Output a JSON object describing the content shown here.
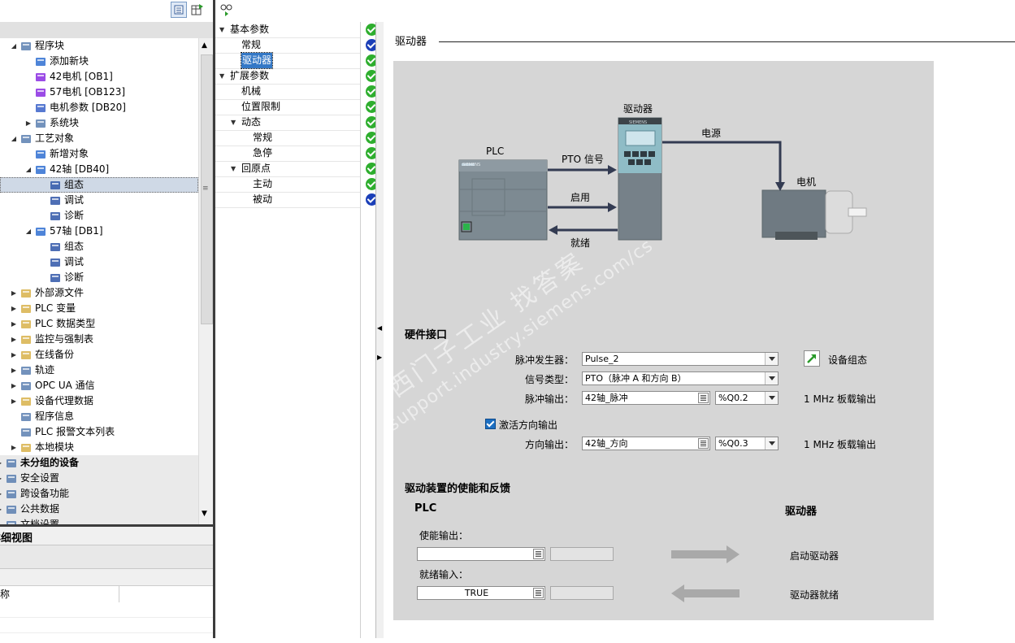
{
  "tree": {
    "items": [
      {
        "label": "程序块",
        "depth": 1,
        "arrow": "down",
        "icon": "program-blocks-icon"
      },
      {
        "label": "添加新块",
        "depth": 2,
        "arrow": "",
        "icon": "add-block-icon"
      },
      {
        "label": "42电机 [OB1]",
        "depth": 2,
        "arrow": "",
        "icon": "ob-block-icon"
      },
      {
        "label": "57电机 [OB123]",
        "depth": 2,
        "arrow": "",
        "icon": "ob-block-icon"
      },
      {
        "label": "电机参数 [DB20]",
        "depth": 2,
        "arrow": "",
        "icon": "db-block-icon"
      },
      {
        "label": "系统块",
        "depth": 2,
        "arrow": "right",
        "icon": "system-blocks-icon"
      },
      {
        "label": "工艺对象",
        "depth": 1,
        "arrow": "down",
        "icon": "technology-objects-icon"
      },
      {
        "label": "新增对象",
        "depth": 2,
        "arrow": "",
        "icon": "add-object-icon"
      },
      {
        "label": "42轴 [DB40]",
        "depth": 2,
        "arrow": "down",
        "icon": "axis-icon"
      },
      {
        "label": "组态",
        "depth": 3,
        "arrow": "",
        "icon": "configuration-icon",
        "selected": true
      },
      {
        "label": "调试",
        "depth": 3,
        "arrow": "",
        "icon": "commissioning-icon"
      },
      {
        "label": "诊断",
        "depth": 3,
        "arrow": "",
        "icon": "diagnostics-icon"
      },
      {
        "label": "57轴 [DB1]",
        "depth": 2,
        "arrow": "down",
        "icon": "axis-icon"
      },
      {
        "label": "组态",
        "depth": 3,
        "arrow": "",
        "icon": "configuration-icon"
      },
      {
        "label": "调试",
        "depth": 3,
        "arrow": "",
        "icon": "commissioning-icon"
      },
      {
        "label": "诊断",
        "depth": 3,
        "arrow": "",
        "icon": "diagnostics-icon"
      },
      {
        "label": "外部源文件",
        "depth": 1,
        "arrow": "right",
        "icon": "folder-icon"
      },
      {
        "label": "PLC 变量",
        "depth": 1,
        "arrow": "right",
        "icon": "folder-icon"
      },
      {
        "label": "PLC 数据类型",
        "depth": 1,
        "arrow": "right",
        "icon": "folder-icon"
      },
      {
        "label": "监控与强制表",
        "depth": 1,
        "arrow": "right",
        "icon": "folder-icon"
      },
      {
        "label": "在线备份",
        "depth": 1,
        "arrow": "right",
        "icon": "folder-icon"
      },
      {
        "label": "轨迹",
        "depth": 1,
        "arrow": "right",
        "icon": "trace-icon"
      },
      {
        "label": "OPC UA 通信",
        "depth": 1,
        "arrow": "right",
        "icon": "opc-ua-icon"
      },
      {
        "label": "设备代理数据",
        "depth": 1,
        "arrow": "right",
        "icon": "folder-icon"
      },
      {
        "label": "程序信息",
        "depth": 1,
        "arrow": "",
        "icon": "program-info-icon"
      },
      {
        "label": "PLC 报警文本列表",
        "depth": 1,
        "arrow": "",
        "icon": "alarm-text-icon"
      },
      {
        "label": "本地模块",
        "depth": 1,
        "arrow": "right",
        "icon": "folder-icon"
      },
      {
        "label": "未分组的设备",
        "depth": 0,
        "arrow": "right",
        "icon": "devices-icon",
        "bold": true,
        "group": true
      },
      {
        "label": "安全设置",
        "depth": 0,
        "arrow": "right",
        "icon": "security-icon",
        "group": true
      },
      {
        "label": "跨设备功能",
        "depth": 0,
        "arrow": "right",
        "icon": "cross-device-icon",
        "group": true
      },
      {
        "label": "公共数据",
        "depth": 0,
        "arrow": "right",
        "icon": "common-data-icon",
        "group": true
      },
      {
        "label": "文档设置",
        "depth": 0,
        "arrow": "right",
        "icon": "doc-settings-icon",
        "group": true
      }
    ]
  },
  "detail_view": {
    "title": "详细视图",
    "col_name": "名称"
  },
  "nav": {
    "items": [
      {
        "label": "基本参数",
        "depth": 0,
        "arrow": "down",
        "status": "green"
      },
      {
        "label": "常规",
        "depth": 1,
        "arrow": "",
        "status": "blue"
      },
      {
        "label": "驱动器",
        "depth": 1,
        "arrow": "",
        "status": "green",
        "selected": true
      },
      {
        "label": "扩展参数",
        "depth": 0,
        "arrow": "down",
        "status": "green"
      },
      {
        "label": "机械",
        "depth": 1,
        "arrow": "",
        "status": "green"
      },
      {
        "label": "位置限制",
        "depth": 1,
        "arrow": "",
        "status": "green"
      },
      {
        "label": "动态",
        "depth": 1,
        "arrow": "down",
        "status": "green"
      },
      {
        "label": "常规",
        "depth": 2,
        "arrow": "",
        "status": "green"
      },
      {
        "label": "急停",
        "depth": 2,
        "arrow": "",
        "status": "green"
      },
      {
        "label": "回原点",
        "depth": 1,
        "arrow": "down",
        "status": "green"
      },
      {
        "label": "主动",
        "depth": 2,
        "arrow": "",
        "status": "green"
      },
      {
        "label": "被动",
        "depth": 2,
        "arrow": "",
        "status": "blue"
      }
    ]
  },
  "main": {
    "section_title": "驱动器",
    "diagram": {
      "plc_label": "PLC",
      "drive_label": "驱动器",
      "motor_label": "电机",
      "power_label": "电源",
      "pto_label": "PTO 信号",
      "enable_label": "启用",
      "ready_label": "就绪",
      "siemens": "SIEMENS"
    },
    "watermark": {
      "line1": "西门子工业  找答案",
      "line2": "support.industry.siemens.com/cs"
    },
    "hw": {
      "title": "硬件接口",
      "pulse_gen_label": "脉冲发生器：",
      "pulse_gen_value": "Pulse_2",
      "device_config_label": "设备组态",
      "signal_type_label": "信号类型：",
      "signal_type_value": "PTO（脉冲 A 和方向 B）",
      "pulse_out_label": "脉冲输出：",
      "pulse_out_value": "42轴_脉冲",
      "pulse_out_addr": "%Q0.2",
      "pulse_out_note": "1 MHz 板载输出",
      "activate_dir_label": "激活方向输出",
      "dir_out_label": "方向输出：",
      "dir_out_value": "42轴_方向",
      "dir_out_addr": "%Q0.3",
      "dir_out_note": "1 MHz 板载输出"
    },
    "enable": {
      "title": "驱动装置的使能和反馈",
      "plc_col": "PLC",
      "drive_col": "驱动器",
      "enable_out_label": "使能输出：",
      "enable_out_value": "",
      "ready_in_label": "就绪输入：",
      "ready_in_value": "TRUE",
      "start_drive_label": "启动驱动器",
      "drive_ready_label": "驱动器就绪"
    }
  }
}
